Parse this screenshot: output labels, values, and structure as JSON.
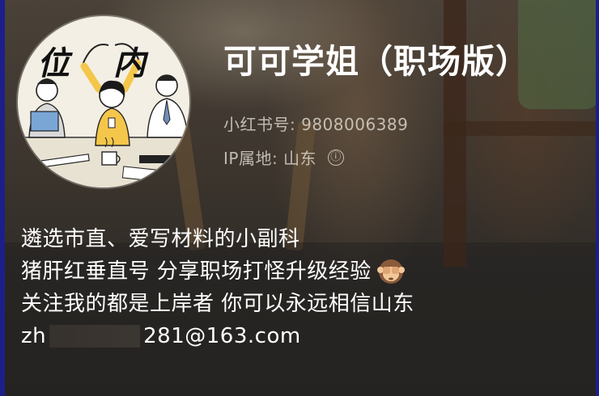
{
  "profile": {
    "nickname": "可可学姐（职场版）",
    "id_label": "小红书号: 9808006389",
    "ip_label": "IP属地: 山东",
    "info_icon": "ⓘ",
    "avatar": {
      "char_left": "位",
      "char_right": "内"
    }
  },
  "bio": {
    "line1": "遴选市直、爱写材料的小副科",
    "line2": "猪肝红垂直号  分享职场打怪升级经验",
    "line2_emoji": "see-no-evil-monkey-icon",
    "line3": "关注我的都是上岸者 你可以永远相信山东",
    "email_prefix": "zh",
    "email_suffix": "281@163.com"
  }
}
